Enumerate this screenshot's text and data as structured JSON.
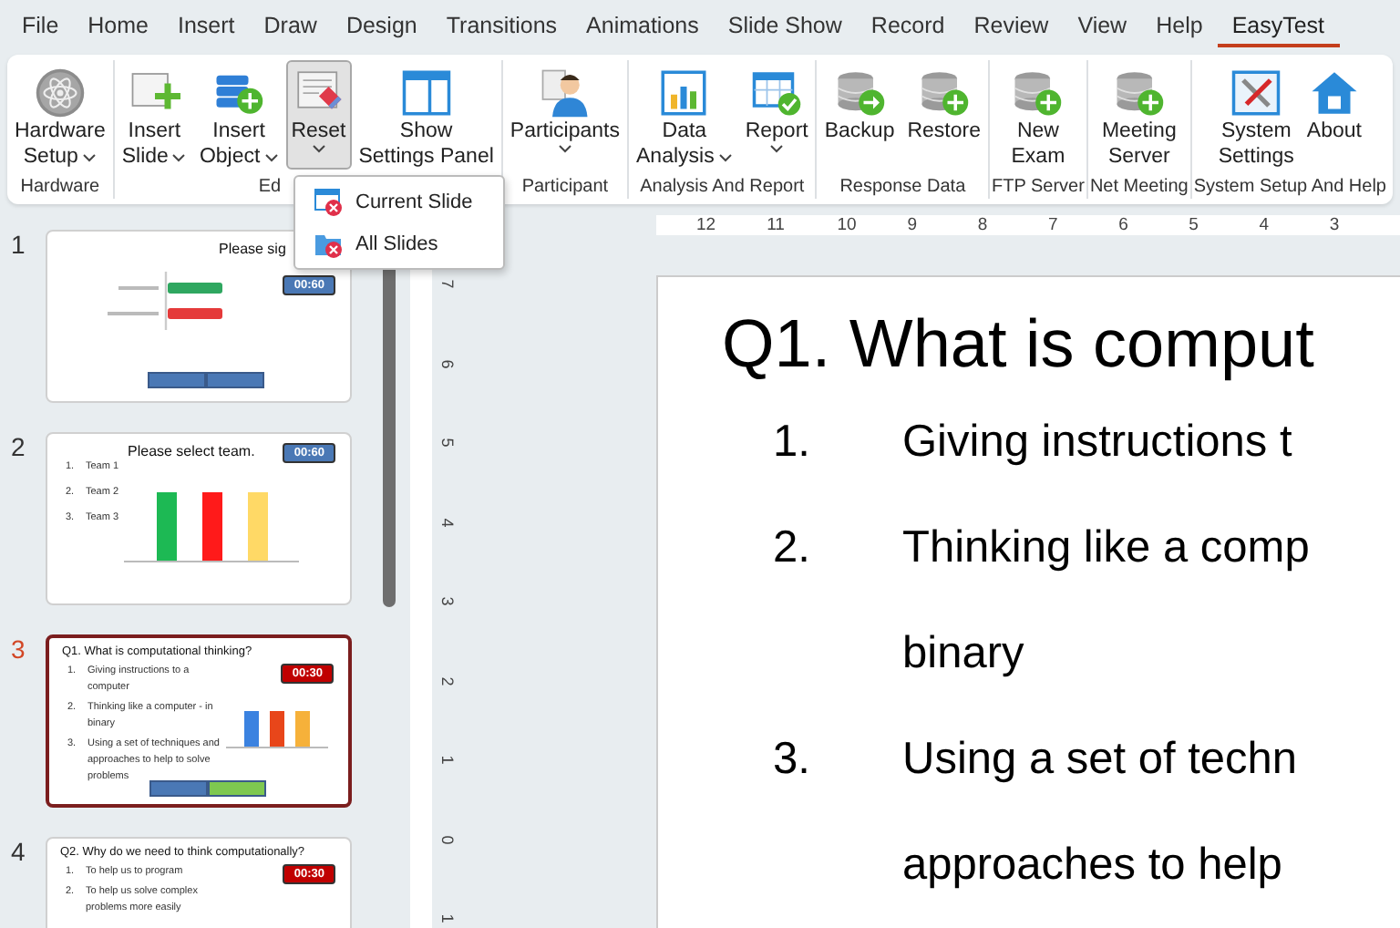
{
  "menu_tabs": [
    {
      "label": "File",
      "selected": false
    },
    {
      "label": "Home",
      "selected": false
    },
    {
      "label": "Insert",
      "selected": false
    },
    {
      "label": "Draw",
      "selected": false
    },
    {
      "label": "Design",
      "selected": false
    },
    {
      "label": "Transitions",
      "selected": false
    },
    {
      "label": "Animations",
      "selected": false
    },
    {
      "label": "Slide Show",
      "selected": false
    },
    {
      "label": "Record",
      "selected": false
    },
    {
      "label": "Review",
      "selected": false
    },
    {
      "label": "View",
      "selected": false
    },
    {
      "label": "Help",
      "selected": false
    },
    {
      "label": "EasyTest",
      "selected": true
    }
  ],
  "ribbon": {
    "groups": [
      {
        "label": "Hardware",
        "buttons": [
          {
            "lines": [
              "Hardware",
              "Setup"
            ],
            "has_menu": true,
            "pressed": false
          }
        ]
      },
      {
        "label": "Ed",
        "buttons": [
          {
            "lines": [
              "Insert",
              "Slide"
            ],
            "has_menu": true,
            "pressed": false
          },
          {
            "lines": [
              "Insert",
              "Object"
            ],
            "has_menu": true,
            "pressed": false
          },
          {
            "lines": [
              "Reset"
            ],
            "has_menu": true,
            "pressed": true
          },
          {
            "lines": [
              "Show",
              "Settings Panel"
            ],
            "has_menu": false,
            "pressed": false
          }
        ]
      },
      {
        "label": "Participant",
        "buttons": [
          {
            "lines": [
              "Participants"
            ],
            "has_menu": true,
            "pressed": false
          }
        ]
      },
      {
        "label": "Analysis And Report",
        "buttons": [
          {
            "lines": [
              "Data",
              "Analysis"
            ],
            "has_menu": true,
            "pressed": false
          },
          {
            "lines": [
              "Report"
            ],
            "has_menu": true,
            "pressed": false
          }
        ]
      },
      {
        "label": "Response Data",
        "buttons": [
          {
            "lines": [
              "Backup"
            ],
            "has_menu": false,
            "pressed": false
          },
          {
            "lines": [
              "Restore"
            ],
            "has_menu": false,
            "pressed": false
          }
        ]
      },
      {
        "label": "FTP Server",
        "buttons": [
          {
            "lines": [
              "New",
              "Exam"
            ],
            "has_menu": false,
            "pressed": false
          }
        ]
      },
      {
        "label": "Net Meeting",
        "buttons": [
          {
            "lines": [
              "Meeting",
              "Server"
            ],
            "has_menu": false,
            "pressed": false
          }
        ]
      },
      {
        "label": "System Setup And Help",
        "buttons": [
          {
            "lines": [
              "System",
              "Settings"
            ],
            "has_menu": false,
            "pressed": false
          },
          {
            "lines": [
              "About"
            ],
            "has_menu": false,
            "pressed": false
          }
        ]
      }
    ]
  },
  "reset_menu": {
    "items": [
      {
        "label": "Current Slide"
      },
      {
        "label": "All Slides"
      }
    ]
  },
  "slides": [
    {
      "kind": "signin",
      "number": "1",
      "selected": false,
      "title": "Please sig",
      "timer": "00:60",
      "footer": [
        {
          "color": "#4a78b5"
        },
        {
          "color": "#4a78b5"
        }
      ]
    },
    {
      "kind": "team",
      "number": "2",
      "selected": false,
      "title": "Please select team.",
      "timer": "00:60",
      "items": [
        {
          "number": "1.",
          "text": "Team 1"
        },
        {
          "number": "2.",
          "text": "Team 2"
        },
        {
          "number": "3.",
          "text": "Team 3"
        }
      ]
    },
    {
      "kind": "question",
      "number": "3",
      "selected": true,
      "title": "Q1. What is computational thinking?",
      "timer": "00:30",
      "items": [
        {
          "number": "1.",
          "text": "Giving instructions to a computer"
        },
        {
          "number": "2.",
          "text": "Thinking like a computer - in binary"
        },
        {
          "number": "3.",
          "text": "Using a set of techniques and approaches to help to solve problems"
        }
      ],
      "footer": [
        {
          "color": "#4a78b5"
        },
        {
          "color": "#7ec850"
        }
      ]
    },
    {
      "kind": "question",
      "number": "4",
      "selected": false,
      "title": "Q2. Why do we need to think computationally?",
      "timer": "00:30",
      "items": [
        {
          "number": "1.",
          "text": "To help us to program"
        },
        {
          "number": "2.",
          "text": "To help us solve complex problems more easily"
        }
      ]
    }
  ],
  "horizontal_ruler": [
    "12",
    "11",
    "10",
    "9",
    "8",
    "7",
    "6",
    "5",
    "4",
    "3"
  ],
  "vertical_ruler": [
    "7",
    "6",
    "5",
    "4",
    "3",
    "2",
    "1",
    "0",
    "1"
  ],
  "main_slide": {
    "title": "Q1. What is comput",
    "items": [
      {
        "number": "1.",
        "lines": [
          "Giving instructions t"
        ]
      },
      {
        "number": "2.",
        "lines": [
          "Thinking like a comp",
          "binary"
        ]
      },
      {
        "number": "3.",
        "lines": [
          "Using a set of techn",
          "approaches to help"
        ]
      }
    ]
  }
}
